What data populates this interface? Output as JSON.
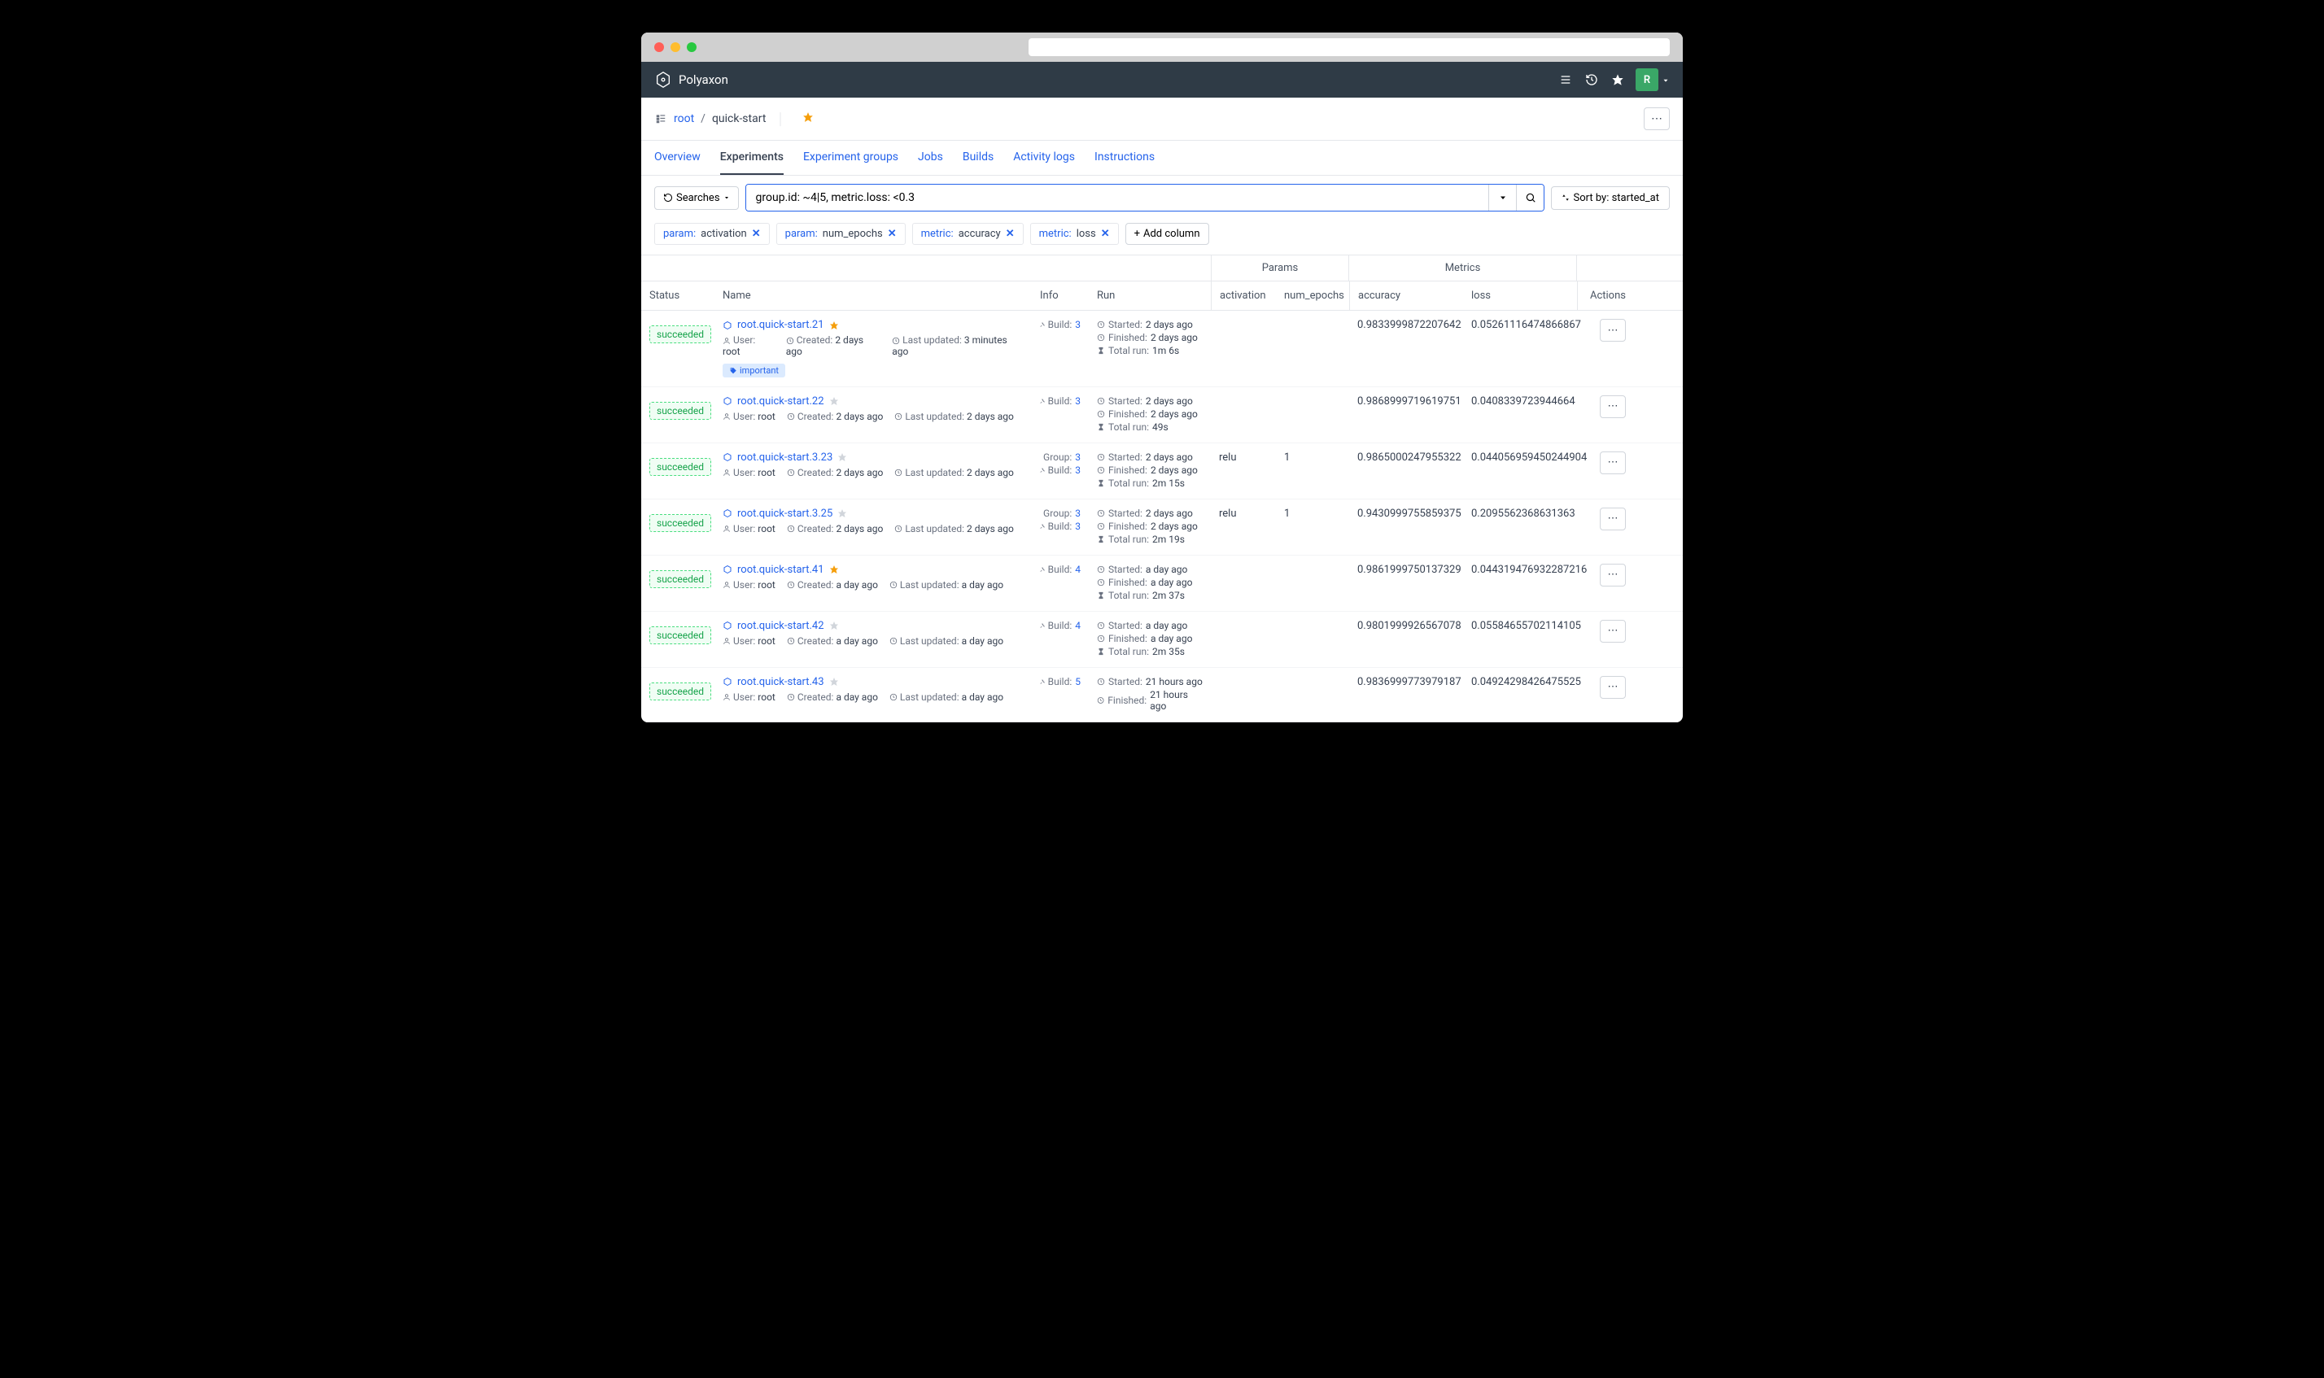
{
  "app_name": "Polyaxon",
  "breadcrumb": {
    "root": "root",
    "project": "quick-start"
  },
  "nav_icons": {
    "avatar_letter": "R"
  },
  "tabs": [
    {
      "label": "Overview",
      "active": false
    },
    {
      "label": "Experiments",
      "active": true
    },
    {
      "label": "Experiment groups",
      "active": false
    },
    {
      "label": "Jobs",
      "active": false
    },
    {
      "label": "Builds",
      "active": false
    },
    {
      "label": "Activity logs",
      "active": false
    },
    {
      "label": "Instructions",
      "active": false
    }
  ],
  "toolbar": {
    "searches_label": "Searches",
    "query": "group.id: ~4|5, metric.loss: <0.3",
    "sort_label": "Sort by: started_at"
  },
  "filters": [
    {
      "key": "param:",
      "value": "activation",
      "closable": true
    },
    {
      "key": "param:",
      "value": "num_epochs",
      "closable": true
    },
    {
      "key": "metric:",
      "value": "accuracy",
      "closable": true
    },
    {
      "key": "metric:",
      "value": "loss",
      "closable": true
    }
  ],
  "add_column_label": "Add column",
  "columns": {
    "status": "Status",
    "name": "Name",
    "info": "Info",
    "run": "Run",
    "params_group": "Params",
    "metrics_group": "Metrics",
    "activation": "activation",
    "num_epochs": "num_epochs",
    "accuracy": "accuracy",
    "loss": "loss",
    "actions": "Actions"
  },
  "labels": {
    "user": "User:",
    "created": "Created:",
    "last_updated": "Last updated:",
    "build": "Build:",
    "group": "Group:",
    "started": "Started:",
    "finished": "Finished:",
    "total_run": "Total run:",
    "status_succeeded": "succeeded",
    "tag_important": "important"
  },
  "rows": [
    {
      "name": "root.quick-start.21",
      "starred": true,
      "user": "root",
      "created": "2 days ago",
      "updated": "3 minutes ago",
      "tags": [
        "important"
      ],
      "group": null,
      "build": "3",
      "started": "2 days ago",
      "finished": "2 days ago",
      "total_run": "1m 6s",
      "activation": "",
      "num_epochs": "",
      "accuracy": "0.9833999872207642",
      "loss": "0.05261116474866867"
    },
    {
      "name": "root.quick-start.22",
      "starred": false,
      "user": "root",
      "created": "2 days ago",
      "updated": "2 days ago",
      "tags": [],
      "group": null,
      "build": "3",
      "started": "2 days ago",
      "finished": "2 days ago",
      "total_run": "49s",
      "activation": "",
      "num_epochs": "",
      "accuracy": "0.9868999719619751",
      "loss": "0.0408339723944664"
    },
    {
      "name": "root.quick-start.3.23",
      "starred": false,
      "user": "root",
      "created": "2 days ago",
      "updated": "2 days ago",
      "tags": [],
      "group": "3",
      "build": "3",
      "started": "2 days ago",
      "finished": "2 days ago",
      "total_run": "2m 15s",
      "activation": "relu",
      "num_epochs": "1",
      "accuracy": "0.9865000247955322",
      "loss": "0.044056959450244904"
    },
    {
      "name": "root.quick-start.3.25",
      "starred": false,
      "user": "root",
      "created": "2 days ago",
      "updated": "2 days ago",
      "tags": [],
      "group": "3",
      "build": "3",
      "started": "2 days ago",
      "finished": "2 days ago",
      "total_run": "2m 19s",
      "activation": "relu",
      "num_epochs": "1",
      "accuracy": "0.9430999755859375",
      "loss": "0.2095562368631363"
    },
    {
      "name": "root.quick-start.41",
      "starred": true,
      "user": "root",
      "created": "a day ago",
      "updated": "a day ago",
      "tags": [],
      "group": null,
      "build": "4",
      "started": "a day ago",
      "finished": "a day ago",
      "total_run": "2m 37s",
      "activation": "",
      "num_epochs": "",
      "accuracy": "0.9861999750137329",
      "loss": "0.044319476932287216"
    },
    {
      "name": "root.quick-start.42",
      "starred": false,
      "user": "root",
      "created": "a day ago",
      "updated": "a day ago",
      "tags": [],
      "group": null,
      "build": "4",
      "started": "a day ago",
      "finished": "a day ago",
      "total_run": "2m 35s",
      "activation": "",
      "num_epochs": "",
      "accuracy": "0.9801999926567078",
      "loss": "0.05584655702114105"
    },
    {
      "name": "root.quick-start.43",
      "starred": false,
      "user": "root",
      "created": "a day ago",
      "updated": "a day ago",
      "tags": [],
      "group": null,
      "build": "5",
      "started": "21 hours ago",
      "finished": "21 hours ago",
      "total_run": "",
      "activation": "",
      "num_epochs": "",
      "accuracy": "0.9836999773979187",
      "loss": "0.04924298426475525"
    }
  ]
}
